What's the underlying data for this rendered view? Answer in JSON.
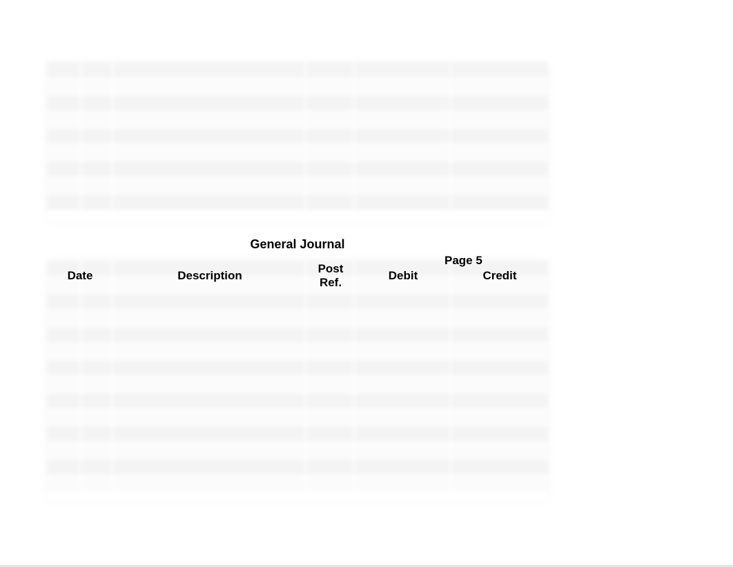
{
  "journal": {
    "title": "General Journal",
    "page_label": "Page 5",
    "columns": {
      "date": "Date",
      "description": "Description",
      "post_ref": "Post\nRef.",
      "debit": "Debit",
      "credit": "Credit"
    }
  }
}
